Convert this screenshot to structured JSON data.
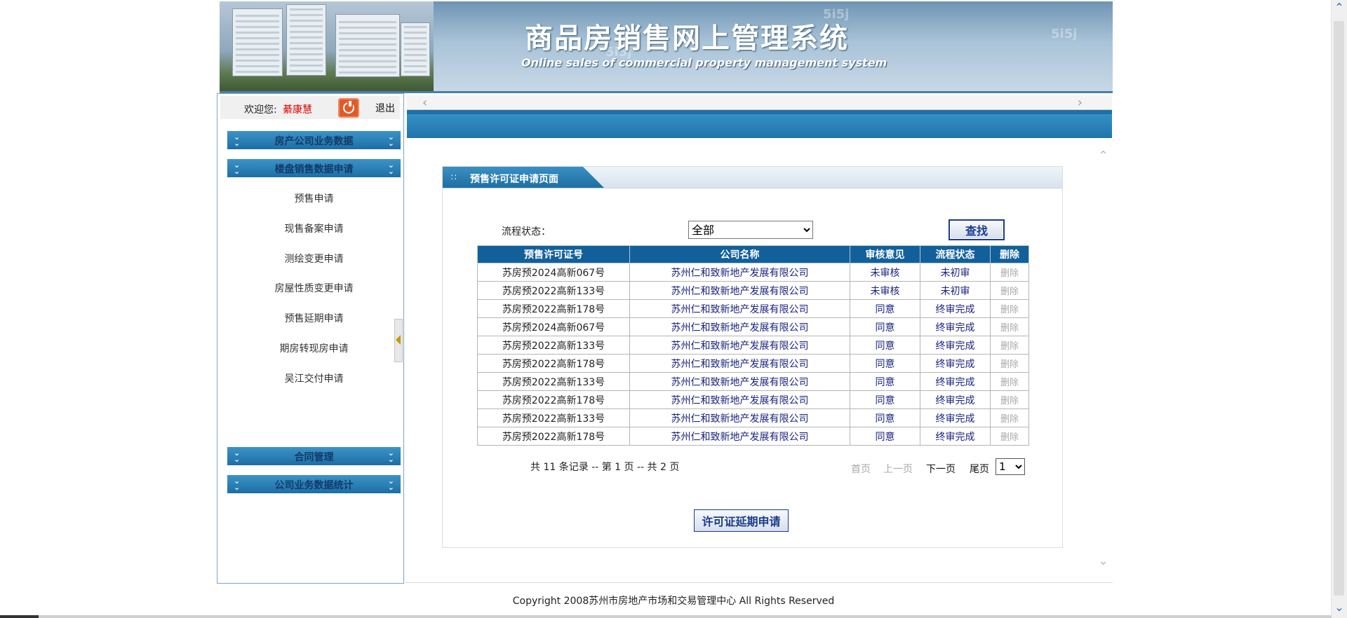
{
  "header": {
    "title_cn": "商品房销售网上管理系统",
    "title_en": "Online sales of commercial property management system"
  },
  "user": {
    "welcome_label": "欢迎您:",
    "name": "綦康慧",
    "logout": "退出"
  },
  "sidebar": {
    "menus": [
      {
        "label": "房产公司业务数据"
      },
      {
        "label": "楼盘销售数据申请"
      },
      {
        "label": "合同管理"
      },
      {
        "label": "公司业务数据统计"
      }
    ],
    "sub_items": [
      {
        "label": "预售申请"
      },
      {
        "label": "现售备案申请"
      },
      {
        "label": "测绘变更申请"
      },
      {
        "label": "房屋性质变更申请"
      },
      {
        "label": "预售延期申请"
      },
      {
        "label": "期房转现房申请"
      },
      {
        "label": "吴江交付申请"
      }
    ]
  },
  "panel": {
    "title": "预售许可证申请页面",
    "filter_label": "流程状态：",
    "filter_value": "全部",
    "find_button": "查找",
    "columns": [
      "预售许可证号",
      "公司名称",
      "审核意见",
      "流程状态",
      "删除"
    ],
    "rows": [
      [
        "苏房预2024高新067号",
        "苏州仁和致新地产发展有限公司",
        "未审核",
        "未初审",
        "删除"
      ],
      [
        "苏房预2022高新133号",
        "苏州仁和致新地产发展有限公司",
        "未审核",
        "未初审",
        "删除"
      ],
      [
        "苏房预2022高新178号",
        "苏州仁和致新地产发展有限公司",
        "同意",
        "终审完成",
        "删除"
      ],
      [
        "苏房预2024高新067号",
        "苏州仁和致新地产发展有限公司",
        "同意",
        "终审完成",
        "删除"
      ],
      [
        "苏房预2022高新133号",
        "苏州仁和致新地产发展有限公司",
        "同意",
        "终审完成",
        "删除"
      ],
      [
        "苏房预2022高新178号",
        "苏州仁和致新地产发展有限公司",
        "同意",
        "终审完成",
        "删除"
      ],
      [
        "苏房预2022高新133号",
        "苏州仁和致新地产发展有限公司",
        "同意",
        "终审完成",
        "删除"
      ],
      [
        "苏房预2022高新178号",
        "苏州仁和致新地产发展有限公司",
        "同意",
        "终审完成",
        "删除"
      ],
      [
        "苏房预2022高新133号",
        "苏州仁和致新地产发展有限公司",
        "同意",
        "终审完成",
        "删除"
      ],
      [
        "苏房预2022高新178号",
        "苏州仁和致新地产发展有限公司",
        "同意",
        "终审完成",
        "删除"
      ]
    ],
    "pager": {
      "summary": "共 11 条记录 -- 第 1 页 -- 共 2 页",
      "first": "首页",
      "prev": "上一页",
      "next": "下一页",
      "last": "尾页",
      "page_value": "1"
    },
    "extend_button": "许可证延期申请"
  },
  "footer": {
    "copyright": "Copyright 2008苏州市房地产市场和交易管理中心  All Rights Reserved"
  }
}
